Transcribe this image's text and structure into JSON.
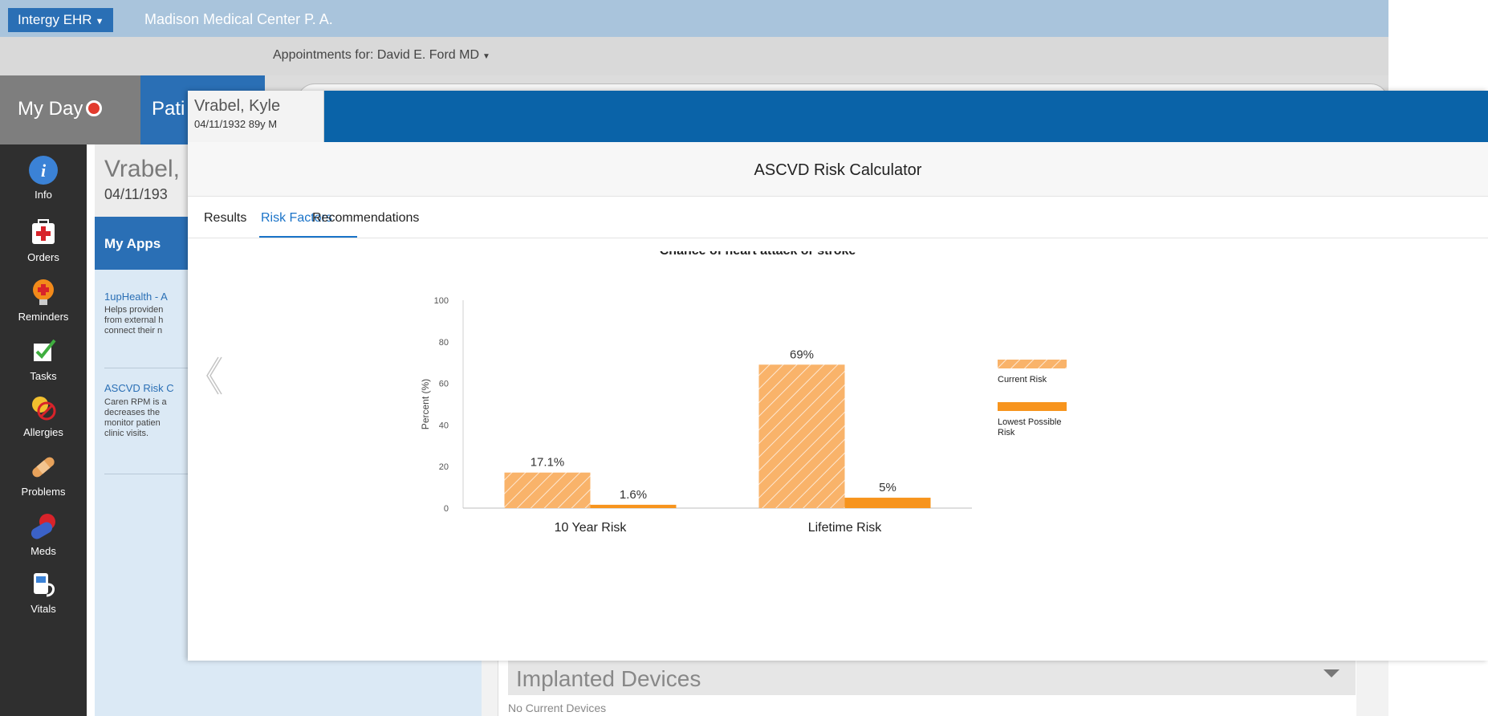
{
  "app": {
    "brand": "Intergy EHR",
    "practice": "Madison Medical Center P. A.",
    "appointments_prefix": "Appointments for:",
    "appointments_provider": "David E. Ford MD"
  },
  "tabs": {
    "my_day": "My Day",
    "patients": "Pati"
  },
  "rail": [
    {
      "label": "Info",
      "icon": "info-icon"
    },
    {
      "label": "Orders",
      "icon": "medical-kit-icon"
    },
    {
      "label": "Reminders",
      "icon": "lightbulb-icon"
    },
    {
      "label": "Tasks",
      "icon": "checklist-icon"
    },
    {
      "label": "Allergies",
      "icon": "allergy-icon"
    },
    {
      "label": "Problems",
      "icon": "bandage-icon"
    },
    {
      "label": "Meds",
      "icon": "pills-icon"
    },
    {
      "label": "Vitals",
      "icon": "vitals-icon"
    }
  ],
  "patient_bg": {
    "name": "Vrabel, K",
    "dob": "04/11/193"
  },
  "my_apps": {
    "heading": "My Apps",
    "apps": [
      {
        "title": "1upHealth - A",
        "desc": "Helps providen\nfrom external h\nconnect their n"
      },
      {
        "title": "ASCVD Risk C",
        "desc": "Caren RPM is a\ndecreases the\nmonitor patien\nclinic visits."
      }
    ]
  },
  "implanted": {
    "title": "Implanted Devices",
    "empty": "No Current Devices"
  },
  "modal": {
    "patient_name": "Vrabel, Kyle",
    "patient_info": "04/11/1932  89y M",
    "title": "ASCVD Risk Calculator",
    "tabs": [
      "Results",
      "Risk Factors",
      "Recommendations"
    ],
    "active_tab": "Risk Factors"
  },
  "colors": {
    "accent": "#1a73c8",
    "bar": "#f7941d",
    "bar_hatched": "#f9b36a",
    "header_blue": "#0a63a8"
  },
  "chart_data": {
    "type": "bar",
    "title": "Chance of heart attack or stroke",
    "ylabel": "Percent (%)",
    "xlabel": "",
    "categories": [
      "10 Year Risk",
      "Lifetime Risk"
    ],
    "series": [
      {
        "name": "Current Risk",
        "values": [
          17.1,
          69
        ],
        "labels": [
          "17.1%",
          "69%"
        ],
        "pattern": "hatched"
      },
      {
        "name": "Lowest Possible Risk",
        "values": [
          1.6,
          5
        ],
        "labels": [
          "1.6%",
          "5%"
        ],
        "pattern": "solid"
      }
    ],
    "ylim": [
      0,
      100
    ],
    "yticks": [
      0,
      20,
      40,
      60,
      80,
      100
    ],
    "grid": false,
    "legend": "right"
  }
}
